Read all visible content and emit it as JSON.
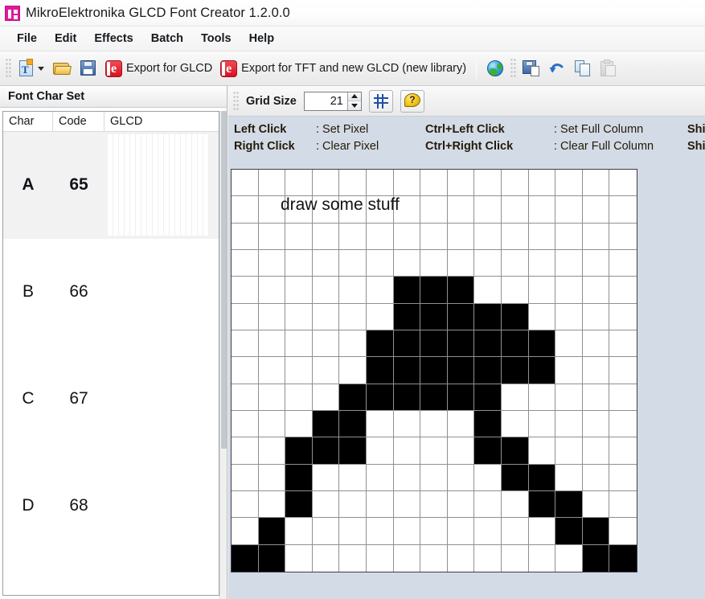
{
  "window": {
    "title": "MikroElektronika GLCD Font Creator 1.2.0.0",
    "icon": "app-icon"
  },
  "menu": {
    "items": [
      {
        "label": "File"
      },
      {
        "label": "Edit"
      },
      {
        "label": "Effects"
      },
      {
        "label": "Batch"
      },
      {
        "label": "Tools"
      },
      {
        "label": "Help"
      }
    ]
  },
  "toolbar": {
    "new_font_icon": "new-document-icon",
    "new_font_dropdown_icon": "chevron-down-icon",
    "open_icon": "open-folder-icon",
    "save_icon": "save-floppy-icon",
    "export_glcd_icon": "export-glcd-icon",
    "export_glcd_label": "Export for GLCD",
    "export_tft_icon": "export-tft-icon",
    "export_tft_label": "Export for TFT and new GLCD (new library)",
    "web_icon": "globe-icon",
    "save_as_icon": "save-as-icon",
    "undo_icon": "undo-arrow-icon",
    "copy_icon": "copy-icon",
    "paste_icon": "paste-icon"
  },
  "left_panel": {
    "header": "Font Char Set",
    "columns": [
      "Char",
      "Code",
      "GLCD"
    ],
    "rows": [
      {
        "char": "A",
        "code": "65",
        "selected": true,
        "has_preview": true
      },
      {
        "char": "B",
        "code": "66",
        "selected": false,
        "has_preview": false
      },
      {
        "char": "C",
        "code": "67",
        "selected": false,
        "has_preview": false
      },
      {
        "char": "D",
        "code": "68",
        "selected": false,
        "has_preview": false
      }
    ]
  },
  "grid_toolbar": {
    "label": "Grid Size",
    "value": "21",
    "spin_up_icon": "triangle-up-icon",
    "spin_down_icon": "triangle-down-icon",
    "toggle_grid_icon": "grid-hash-icon",
    "help_icon": "help-question-icon"
  },
  "legend": {
    "rows": [
      {
        "cells": [
          {
            "key": "Left Click",
            "value": ": Set Pixel"
          },
          {
            "key": "Ctrl+Left Click",
            "value": ": Set Full Column"
          },
          {
            "key": "Shift+",
            "value": ""
          }
        ]
      },
      {
        "cells": [
          {
            "key": "Right Click",
            "value": ": Clear Pixel"
          },
          {
            "key": "Ctrl+Right Click",
            "value": ": Clear Full Column"
          },
          {
            "key": "Shift+",
            "value": ""
          }
        ]
      }
    ]
  },
  "canvas": {
    "annotation": "draw some stuff",
    "cols": 15,
    "rows": 15,
    "on_color": "#000000",
    "off_color": "#ffffff",
    "grid_line_color": "#8c9196",
    "pixels": [
      [
        0,
        0,
        0,
        0,
        0,
        0,
        0,
        0,
        0,
        0,
        0,
        0,
        0,
        0,
        0
      ],
      [
        0,
        0,
        0,
        0,
        0,
        0,
        0,
        0,
        0,
        0,
        0,
        0,
        0,
        0,
        0
      ],
      [
        0,
        0,
        0,
        0,
        0,
        0,
        0,
        0,
        0,
        0,
        0,
        0,
        0,
        0,
        0
      ],
      [
        0,
        0,
        0,
        0,
        0,
        0,
        0,
        0,
        0,
        0,
        0,
        0,
        0,
        0,
        0
      ],
      [
        0,
        0,
        0,
        0,
        0,
        0,
        1,
        1,
        1,
        0,
        0,
        0,
        0,
        0,
        0
      ],
      [
        0,
        0,
        0,
        0,
        0,
        0,
        1,
        1,
        1,
        1,
        1,
        0,
        0,
        0,
        0
      ],
      [
        0,
        0,
        0,
        0,
        0,
        1,
        1,
        1,
        1,
        1,
        1,
        1,
        0,
        0,
        0
      ],
      [
        0,
        0,
        0,
        0,
        0,
        1,
        1,
        1,
        1,
        1,
        1,
        1,
        0,
        0,
        0
      ],
      [
        0,
        0,
        0,
        0,
        1,
        1,
        1,
        1,
        1,
        1,
        0,
        0,
        0,
        0,
        0
      ],
      [
        0,
        0,
        0,
        1,
        1,
        0,
        0,
        0,
        0,
        1,
        0,
        0,
        0,
        0,
        0
      ],
      [
        0,
        0,
        1,
        1,
        1,
        0,
        0,
        0,
        0,
        1,
        1,
        0,
        0,
        0,
        0
      ],
      [
        0,
        0,
        1,
        0,
        0,
        0,
        0,
        0,
        0,
        0,
        1,
        1,
        0,
        0,
        0
      ],
      [
        0,
        0,
        1,
        0,
        0,
        0,
        0,
        0,
        0,
        0,
        0,
        1,
        1,
        0,
        0
      ],
      [
        0,
        1,
        0,
        0,
        0,
        0,
        0,
        0,
        0,
        0,
        0,
        0,
        1,
        1,
        0
      ],
      [
        1,
        1,
        0,
        0,
        0,
        0,
        0,
        0,
        0,
        0,
        0,
        0,
        0,
        1,
        1
      ]
    ]
  }
}
